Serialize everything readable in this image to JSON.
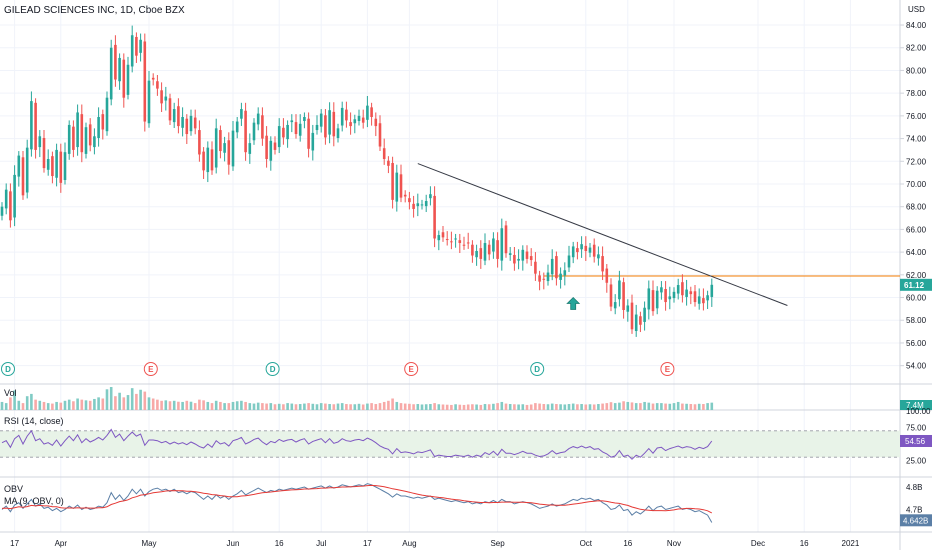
{
  "header": {
    "title": "GILEAD SCIENCES INC, 1D, Cboe BZX",
    "currency": "USD"
  },
  "colors": {
    "up": "#26a69a",
    "down": "#ef5350",
    "up_vol": "#80cbc4",
    "down_vol": "#f7a9a7",
    "trendline": "#363a45",
    "hline": "#f57c00",
    "rsi_line": "#7e57c2",
    "rsi_band": "#e8f3e8",
    "obv_line": "#5b7fa6",
    "obv_ma": "#e53935",
    "arrow": "#26a69a",
    "grid": "#f0f3fa",
    "axis": "#d1d4dc"
  },
  "chart_data": [
    {
      "type": "candlestick",
      "pane": "price",
      "title": "GILEAD SCIENCES INC, 1D, Cboe BZX",
      "ylim": [
        53,
        85.5
      ],
      "y_ticks": [
        "84.00",
        "82.00",
        "80.00",
        "78.00",
        "76.00",
        "74.00",
        "72.00",
        "70.00",
        "68.00",
        "66.00",
        "64.00",
        "62.00",
        "60.00",
        "58.00",
        "56.00",
        "54.00"
      ],
      "x_ticks": [
        {
          "label": "17",
          "index": 3
        },
        {
          "label": "Apr",
          "index": 14
        },
        {
          "label": "May",
          "index": 35
        },
        {
          "label": "Jun",
          "index": 55
        },
        {
          "label": "16",
          "index": 66
        },
        {
          "label": "Jul",
          "index": 76
        },
        {
          "label": "17",
          "index": 87
        },
        {
          "label": "Aug",
          "index": 97
        },
        {
          "label": "Sep",
          "index": 118
        },
        {
          "label": "Oct",
          "index": 139
        },
        {
          "label": "16",
          "index": 149
        },
        {
          "label": "Nov",
          "index": 160
        },
        {
          "label": "Dec",
          "index": 180
        },
        {
          "label": "16",
          "index": 191
        },
        {
          "label": "2021",
          "index": 202
        }
      ],
      "last_price": "61.12",
      "x_start": 2,
      "x_step": 4.2,
      "closes": [
        68.0,
        69.5,
        66.8,
        70.8,
        72.5,
        69.0,
        73.2,
        77.3,
        73.0,
        74.2,
        71.4,
        72.2,
        70.7,
        73.0,
        70.1,
        72.8,
        75.2,
        73.0,
        76.3,
        72.8,
        75.0,
        73.4,
        74.2,
        75.9,
        74.8,
        77.6,
        82.0,
        79.2,
        81.1,
        77.6,
        80.5,
        83.1,
        81.3,
        82.7,
        75.5,
        79.1,
        79.2,
        78.4,
        77.1,
        77.7,
        75.6,
        76.6,
        75.1,
        75.9,
        74.4,
        76.0,
        74.9,
        72.6,
        71.2,
        73.2,
        71.2,
        74.9,
        72.9,
        73.6,
        71.7,
        74.7,
        75.5,
        76.6,
        72.8,
        73.6,
        75.4,
        76.2,
        74.0,
        72.2,
        73.8,
        73.0,
        75.1,
        74.1,
        75.2,
        75.6,
        74.4,
        75.3,
        75.9,
        73.1,
        74.5,
        75.2,
        76.2,
        74.1,
        76.5,
        74.2,
        74.9,
        76.7,
        75.6,
        75.1,
        75.7,
        76.0,
        75.4,
        76.9,
        75.9,
        75.1,
        73.3,
        72.2,
        71.6,
        68.6,
        71.0,
        68.8,
        68.9,
        68.4,
        67.8,
        68.3,
        68.2,
        68.5,
        69.1,
        65.2,
        65.5,
        65.3,
        65.1,
        64.9,
        65.2,
        64.8,
        64.6,
        64.8,
        63.7,
        64.1,
        63.4,
        64.8,
        63.8,
        65.2,
        63.4,
        66.1,
        63.9,
        63.9,
        63.0,
        63.4,
        64.2,
        63.4,
        63.3,
        62.1,
        61.4,
        61.6,
        62.2,
        63.4,
        61.7,
        62.1,
        62.4,
        63.7,
        64.5,
        64.0,
        64.7,
        64.1,
        64.4,
        63.6,
        63.8,
        62.3,
        61.3,
        59.2,
        59.6,
        61.5,
        58.9,
        59.3,
        57.2,
        58.5,
        57.6,
        59.1,
        60.8,
        58.8,
        60.6,
        60.9,
        59.6,
        60.1,
        60.5,
        61.1,
        60.2,
        60.7,
        60.3,
        59.6,
        60.1,
        59.5,
        60.2,
        61.12
      ]
    },
    {
      "type": "bar",
      "pane": "volume",
      "title": "Vol",
      "last_value": "7.4M",
      "values": [
        0.35,
        0.3,
        0.55,
        0.85,
        0.4,
        0.3,
        0.6,
        0.7,
        0.45,
        0.4,
        0.35,
        0.3,
        0.28,
        0.35,
        0.32,
        0.4,
        0.45,
        0.38,
        0.5,
        0.45,
        0.42,
        0.4,
        0.48,
        0.55,
        0.5,
        0.9,
        1.0,
        0.6,
        0.75,
        0.55,
        0.65,
        0.95,
        0.7,
        0.88,
        0.8,
        0.55,
        0.5,
        0.45,
        0.4,
        0.42,
        0.38,
        0.4,
        0.36,
        0.35,
        0.4,
        0.36,
        0.3,
        0.45,
        0.42,
        0.35,
        0.3,
        0.4,
        0.35,
        0.3,
        0.3,
        0.35,
        0.38,
        0.4,
        0.35,
        0.3,
        0.28,
        0.32,
        0.3,
        0.28,
        0.3,
        0.25,
        0.27,
        0.25,
        0.3,
        0.28,
        0.25,
        0.26,
        0.28,
        0.3,
        0.27,
        0.25,
        0.3,
        0.28,
        0.26,
        0.25,
        0.28,
        0.3,
        0.26,
        0.25,
        0.25,
        0.27,
        0.24,
        0.28,
        0.3,
        0.26,
        0.3,
        0.35,
        0.4,
        0.5,
        0.35,
        0.3,
        0.28,
        0.27,
        0.25,
        0.26,
        0.24,
        0.25,
        0.26,
        0.3,
        0.25,
        0.24,
        0.23,
        0.22,
        0.25,
        0.23,
        0.22,
        0.24,
        0.25,
        0.24,
        0.22,
        0.26,
        0.25,
        0.27,
        0.3,
        0.35,
        0.28,
        0.26,
        0.25,
        0.24,
        0.25,
        0.22,
        0.24,
        0.3,
        0.28,
        0.26,
        0.25,
        0.28,
        0.26,
        0.25,
        0.24,
        0.26,
        0.28,
        0.25,
        0.26,
        0.24,
        0.25,
        0.24,
        0.26,
        0.28,
        0.3,
        0.34,
        0.3,
        0.32,
        0.38,
        0.35,
        0.33,
        0.3,
        0.3,
        0.35,
        0.32,
        0.28,
        0.3,
        0.3,
        0.28,
        0.27,
        0.3,
        0.35,
        0.28,
        0.27,
        0.26,
        0.25,
        0.27,
        0.26,
        0.3,
        0.32
      ]
    },
    {
      "type": "line",
      "pane": "rsi",
      "title": "RSI (14, close)",
      "last_value": "54.56",
      "y_ticks": [
        "100.00",
        "75.00",
        "25.00"
      ],
      "band": [
        30,
        70
      ],
      "values": [
        52,
        55,
        45,
        58,
        63,
        50,
        62,
        70,
        55,
        58,
        50,
        52,
        48,
        56,
        47,
        55,
        62,
        55,
        64,
        52,
        58,
        53,
        56,
        60,
        56,
        63,
        72,
        60,
        65,
        55,
        62,
        68,
        62,
        65,
        48,
        56,
        56,
        55,
        52,
        54,
        50,
        53,
        50,
        52,
        49,
        53,
        50,
        46,
        44,
        50,
        45,
        55,
        50,
        52,
        47,
        55,
        57,
        60,
        50,
        53,
        57,
        59,
        53,
        49,
        54,
        52,
        57,
        54,
        56,
        57,
        53,
        56,
        58,
        50,
        54,
        56,
        58,
        52,
        58,
        51,
        53,
        58,
        55,
        54,
        56,
        57,
        55,
        59,
        56,
        52,
        47,
        44,
        42,
        35,
        43,
        37,
        38,
        37,
        35,
        38,
        37,
        39,
        41,
        31,
        33,
        32,
        31,
        31,
        33,
        32,
        31,
        33,
        30,
        33,
        31,
        37,
        34,
        39,
        33,
        42,
        36,
        36,
        34,
        36,
        39,
        36,
        36,
        33,
        31,
        32,
        35,
        40,
        35,
        37,
        38,
        43,
        46,
        44,
        47,
        44,
        46,
        42,
        43,
        38,
        35,
        30,
        32,
        40,
        31,
        33,
        27,
        33,
        30,
        36,
        43,
        36,
        44,
        45,
        40,
        43,
        45,
        47,
        44,
        46,
        45,
        42,
        45,
        43,
        46,
        54.56
      ]
    },
    {
      "type": "line",
      "pane": "obv",
      "title": "OBV",
      "subtitle": "MA (9, OBV, 0)",
      "last_value": "4.642B",
      "y_ticks": [
        "4.8B",
        "4.7B"
      ],
      "ylim": [
        4.6,
        4.84
      ],
      "values": [
        4.7,
        4.715,
        4.69,
        4.72,
        4.73,
        4.705,
        4.725,
        4.745,
        4.715,
        4.725,
        4.705,
        4.71,
        4.695,
        4.705,
        4.69,
        4.7,
        4.715,
        4.705,
        4.72,
        4.7,
        4.71,
        4.7,
        4.705,
        4.715,
        4.71,
        4.73,
        4.775,
        4.745,
        4.765,
        4.74,
        4.76,
        4.79,
        4.77,
        4.79,
        4.76,
        4.78,
        4.79,
        4.795,
        4.785,
        4.79,
        4.78,
        4.79,
        4.775,
        4.78,
        4.77,
        4.78,
        4.775,
        4.76,
        4.745,
        4.76,
        4.745,
        4.765,
        4.75,
        4.76,
        4.745,
        4.76,
        4.77,
        4.785,
        4.765,
        4.775,
        4.785,
        4.795,
        4.785,
        4.775,
        4.785,
        4.78,
        4.79,
        4.785,
        4.79,
        4.795,
        4.79,
        4.795,
        4.8,
        4.79,
        4.795,
        4.8,
        4.805,
        4.795,
        4.805,
        4.795,
        4.8,
        4.81,
        4.805,
        4.8,
        4.805,
        4.81,
        4.805,
        4.815,
        4.81,
        4.8,
        4.79,
        4.78,
        4.77,
        4.755,
        4.77,
        4.76,
        4.76,
        4.755,
        4.75,
        4.755,
        4.75,
        4.755,
        4.76,
        4.745,
        4.75,
        4.745,
        4.74,
        4.735,
        4.74,
        4.735,
        4.73,
        4.735,
        4.725,
        4.73,
        4.725,
        4.735,
        4.73,
        4.74,
        4.73,
        4.745,
        4.735,
        4.735,
        4.725,
        4.73,
        4.735,
        4.73,
        4.725,
        4.715,
        4.705,
        4.71,
        4.715,
        4.725,
        4.715,
        4.72,
        4.725,
        4.735,
        4.745,
        4.74,
        4.75,
        4.745,
        4.75,
        4.74,
        4.745,
        4.73,
        4.72,
        4.7,
        4.705,
        4.72,
        4.695,
        4.7,
        4.675,
        4.69,
        4.68,
        4.695,
        4.715,
        4.695,
        4.71,
        4.715,
        4.7,
        4.705,
        4.71,
        4.715,
        4.7,
        4.705,
        4.7,
        4.69,
        4.695,
        4.685,
        4.675,
        4.642
      ],
      "ma_values": [
        4.705,
        4.706,
        4.704,
        4.708,
        4.712,
        4.71,
        4.713,
        4.718,
        4.716,
        4.718,
        4.716,
        4.716,
        4.712,
        4.712,
        4.708,
        4.706,
        4.707,
        4.706,
        4.708,
        4.706,
        4.707,
        4.706,
        4.706,
        4.708,
        4.708,
        4.712,
        4.722,
        4.728,
        4.735,
        4.738,
        4.743,
        4.752,
        4.757,
        4.764,
        4.766,
        4.77,
        4.774,
        4.777,
        4.779,
        4.782,
        4.783,
        4.784,
        4.783,
        4.783,
        4.781,
        4.781,
        4.779,
        4.776,
        4.772,
        4.77,
        4.766,
        4.765,
        4.762,
        4.76,
        4.757,
        4.757,
        4.757,
        4.76,
        4.761,
        4.764,
        4.767,
        4.771,
        4.774,
        4.776,
        4.778,
        4.78,
        4.782,
        4.784,
        4.786,
        4.787,
        4.788,
        4.789,
        4.791,
        4.791,
        4.792,
        4.793,
        4.795,
        4.795,
        4.797,
        4.797,
        4.798,
        4.8,
        4.8,
        4.801,
        4.802,
        4.803,
        4.804,
        4.806,
        4.807,
        4.806,
        4.804,
        4.801,
        4.797,
        4.792,
        4.789,
        4.785,
        4.781,
        4.777,
        4.772,
        4.768,
        4.764,
        4.761,
        4.759,
        4.756,
        4.754,
        4.752,
        4.749,
        4.746,
        4.744,
        4.742,
        4.739,
        4.737,
        4.734,
        4.733,
        4.731,
        4.731,
        4.73,
        4.731,
        4.731,
        4.733,
        4.733,
        4.733,
        4.732,
        4.732,
        4.732,
        4.731,
        4.73,
        4.727,
        4.724,
        4.722,
        4.72,
        4.72,
        4.719,
        4.719,
        4.719,
        4.721,
        4.724,
        4.726,
        4.729,
        4.732,
        4.735,
        4.737,
        4.739,
        4.738,
        4.736,
        4.732,
        4.729,
        4.727,
        4.722,
        4.718,
        4.711,
        4.706,
        4.701,
        4.698,
        4.697,
        4.695,
        4.695,
        4.695,
        4.694,
        4.696,
        4.698,
        4.702,
        4.703,
        4.705,
        4.705,
        4.703,
        4.702,
        4.699,
        4.694,
        4.685
      ]
    }
  ],
  "annotations": {
    "event_badges": [
      {
        "label": "D",
        "kind": "dividend",
        "index": 0
      },
      {
        "label": "E",
        "kind": "earnings",
        "index": 34
      },
      {
        "label": "D",
        "kind": "dividend",
        "index": 63
      },
      {
        "label": "E",
        "kind": "earnings",
        "index": 96
      },
      {
        "label": "D",
        "kind": "dividend",
        "index": 126
      },
      {
        "label": "E",
        "kind": "earnings",
        "index": 157
      }
    ],
    "trendline": {
      "from": {
        "index": 99,
        "price": 71.8
      },
      "to": {
        "index": 187,
        "price": 59.3
      }
    },
    "horizontal_line": {
      "price": 61.9,
      "from_index": 129
    },
    "arrow": {
      "index": 136,
      "price": 60.0
    }
  }
}
